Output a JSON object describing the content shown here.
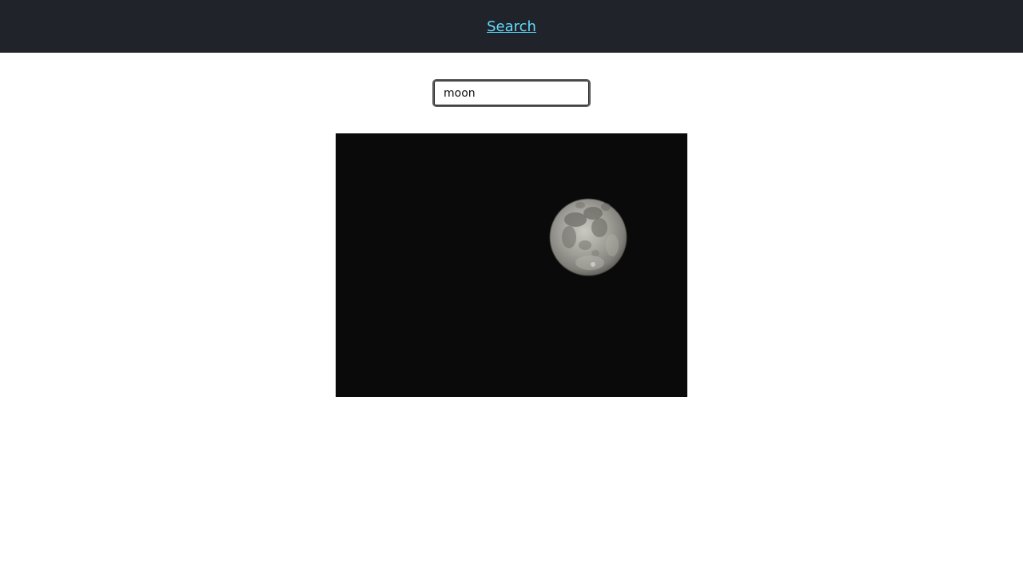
{
  "header": {
    "nav_link_label": "Search"
  },
  "search": {
    "value": "moon"
  },
  "result": {
    "image_subject": "full-moon-photo"
  },
  "colors": {
    "header_bg": "#20232a",
    "link": "#61dafb",
    "image_bg": "#0a0a0a"
  }
}
